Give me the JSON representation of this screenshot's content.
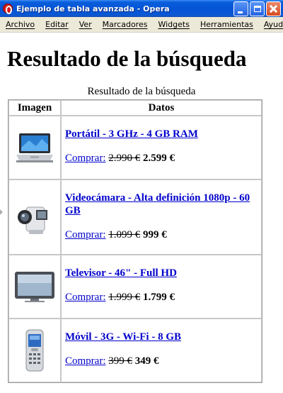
{
  "window": {
    "title": "Ejemplo de tabla avanzada - Opera",
    "icon": "opera-icon"
  },
  "menu": {
    "items": [
      {
        "label": "Archivo"
      },
      {
        "label": "Editar"
      },
      {
        "label": "Ver"
      },
      {
        "label": "Marcadores"
      },
      {
        "label": "Widgets"
      },
      {
        "label": "Herramientas"
      },
      {
        "label": "Ayuda"
      }
    ]
  },
  "page": {
    "heading": "Resultado de la búsqueda",
    "table": {
      "caption": "Resultado de la búsqueda",
      "headers": [
        "Imagen",
        "Datos"
      ],
      "rows": [
        {
          "image": "laptop-image",
          "product": "Portátil - 3 GHz - 4 GB RAM",
          "buy_label": "Comprar:",
          "old_price": "2.990 €",
          "new_price": "2.599 €"
        },
        {
          "image": "camcorder-image",
          "product": "Videocámara - Alta definición 1080p - 60 GB",
          "buy_label": "Comprar:",
          "old_price": "1.099 €",
          "new_price": "999 €"
        },
        {
          "image": "television-image",
          "product": "Televisor - 46\" - Full HD",
          "buy_label": "Comprar:",
          "old_price": "1.999 €",
          "new_price": "1.799 €"
        },
        {
          "image": "mobile-phone-image",
          "product": "Móvil - 3G - Wi-Fi - 8 GB",
          "buy_label": "Comprar:",
          "old_price": "399 €",
          "new_price": "349 €"
        }
      ]
    }
  },
  "colors": {
    "titlebar": "#0454d6",
    "menubar": "#ece9d8",
    "link": "#0000cc"
  }
}
